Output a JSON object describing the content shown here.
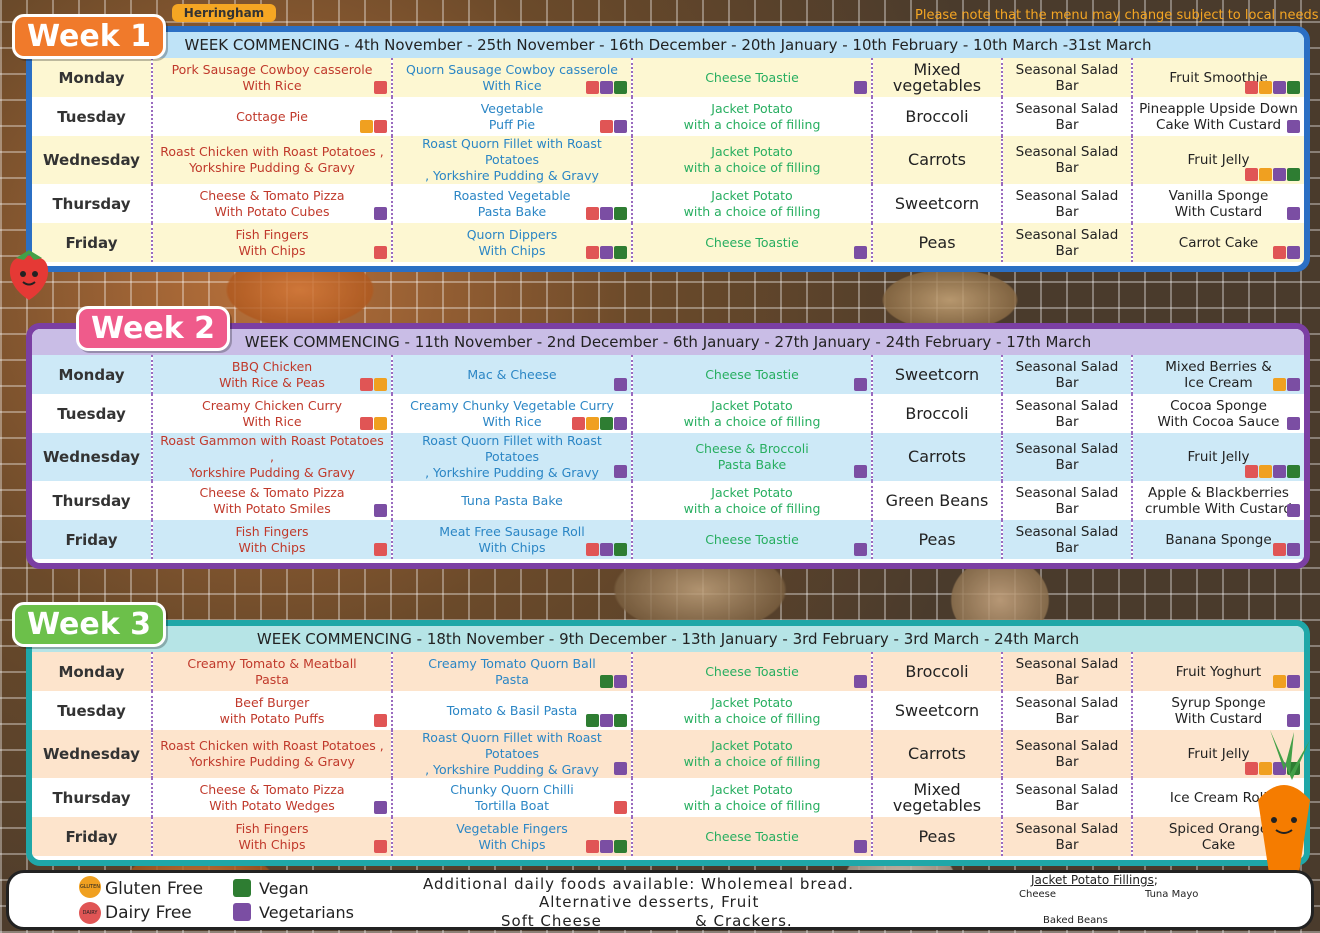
{
  "school": "Herringham",
  "note": "Please note that the menu may change subject to local needs",
  "weeks": [
    {
      "badge": "Week 1",
      "commencing": "WEEK COMMENCING - 4th November - 25th November - 16th December -  20th January - 10th February - 10th March -31st March",
      "color": "#2b6fc4",
      "rows": [
        {
          "day": "Monday",
          "main": "Pork Sausage Cowboy casserole\nWith Rice",
          "main_icons": [
            "df"
          ],
          "alt": "Quorn Sausage Cowboy casserole\nWith Rice",
          "alt_icons": [
            "df",
            "v",
            "vg"
          ],
          "third": "Cheese Toastie",
          "third_icons": [
            "v"
          ],
          "veg": "Mixed\nvegetables",
          "salad": "Seasonal Salad\nBar",
          "dessert": "Fruit Smoothie",
          "dessert_icons": [
            "df",
            "gf",
            "v",
            "vg"
          ]
        },
        {
          "day": "Tuesday",
          "main": "Cottage Pie",
          "main_icons": [
            "gf",
            "df"
          ],
          "alt": "Vegetable\nPuff Pie",
          "alt_icons": [
            "df",
            "v"
          ],
          "third": "Jacket Potato\nwith a choice of filling",
          "third_icons": [],
          "veg": "Broccoli",
          "salad": "Seasonal Salad\nBar",
          "dessert": "Pineapple Upside Down\nCake With Custard",
          "dessert_icons": [
            "v"
          ]
        },
        {
          "day": "Wednesday",
          "main": "Roast Chicken with Roast Potatoes ,\nYorkshire Pudding & Gravy",
          "main_icons": [],
          "alt": "Roast Quorn Fillet with Roast Potatoes\n, Yorkshire Pudding & Gravy",
          "alt_icons": [],
          "third": "Jacket Potato\nwith a choice of filling",
          "third_icons": [],
          "veg": "Carrots",
          "salad": "Seasonal Salad\nBar",
          "dessert": "Fruit Jelly",
          "dessert_icons": [
            "df",
            "gf",
            "v",
            "vg"
          ]
        },
        {
          "day": "Thursday",
          "main": "Cheese & Tomato Pizza\nWith Potato Cubes",
          "main_icons": [
            "v"
          ],
          "alt": "Roasted Vegetable\nPasta Bake",
          "alt_icons": [
            "df",
            "v",
            "vg"
          ],
          "third": "Jacket Potato\nwith a choice of filling",
          "third_icons": [],
          "veg": "Sweetcorn",
          "salad": "Seasonal Salad\nBar",
          "dessert": "Vanilla Sponge\nWith Custard",
          "dessert_icons": [
            "v"
          ]
        },
        {
          "day": "Friday",
          "main": "Fish Fingers\nWith Chips",
          "main_icons": [
            "df"
          ],
          "alt": "Quorn Dippers\nWith Chips",
          "alt_icons": [
            "df",
            "v",
            "vg"
          ],
          "third": "Cheese Toastie",
          "third_icons": [
            "v"
          ],
          "veg": "Peas",
          "salad": "Seasonal Salad\nBar",
          "dessert": "Carrot Cake",
          "dessert_icons": [
            "df",
            "v"
          ]
        }
      ]
    },
    {
      "badge": "Week 2",
      "commencing": "WEEK COMMENCING - 11th November - 2nd December - 6th January - 27th January - 24th February - 17th March",
      "color": "#7b3fa3",
      "rows": [
        {
          "day": "Monday",
          "main": "BBQ Chicken\nWith Rice & Peas",
          "main_icons": [
            "df",
            "gf"
          ],
          "alt": "Mac & Cheese",
          "alt_icons": [
            "v"
          ],
          "third": "Cheese Toastie",
          "third_icons": [
            "v"
          ],
          "veg": "Sweetcorn",
          "salad": "Seasonal Salad\nBar",
          "dessert": "Mixed Berries &\nIce Cream",
          "dessert_icons": [
            "gf",
            "v"
          ]
        },
        {
          "day": "Tuesday",
          "main": "Creamy Chicken Curry\nWith Rice",
          "main_icons": [
            "df",
            "gf"
          ],
          "alt": "Creamy Chunky Vegetable  Curry\nWith Rice",
          "alt_icons": [
            "df",
            "gf",
            "vg",
            "v"
          ],
          "third": "Jacket Potato\nwith a choice of filling",
          "third_icons": [],
          "veg": "Broccoli",
          "salad": "Seasonal Salad\nBar",
          "dessert": "Cocoa Sponge\nWith Cocoa Sauce",
          "dessert_icons": [
            "v"
          ]
        },
        {
          "day": "Wednesday",
          "main": "Roast Gammon with Roast Potatoes ,\nYorkshire Pudding & Gravy",
          "main_icons": [],
          "alt": "Roast Quorn Fillet with Roast Potatoes\n, Yorkshire Pudding & Gravy",
          "alt_icons": [
            "v"
          ],
          "third": "Cheese & Broccoli\nPasta Bake",
          "third_icons": [
            "v"
          ],
          "veg": "Carrots",
          "salad": "Seasonal Salad\nBar",
          "dessert": "Fruit Jelly",
          "dessert_icons": [
            "df",
            "gf",
            "v",
            "vg"
          ]
        },
        {
          "day": "Thursday",
          "main": "Cheese & Tomato Pizza\nWith Potato Smiles",
          "main_icons": [
            "v"
          ],
          "alt": "Tuna Pasta Bake",
          "alt_icons": [],
          "third": "Jacket Potato\nwith a choice of filling",
          "third_icons": [],
          "veg": "Green Beans",
          "salad": "Seasonal Salad\nBar",
          "dessert": "Apple & Blackberries\ncrumble With Custard",
          "dessert_icons": [
            "v"
          ]
        },
        {
          "day": "Friday",
          "main": "Fish Fingers\nWith Chips",
          "main_icons": [
            "df"
          ],
          "alt": "Meat Free Sausage Roll\nWith Chips",
          "alt_icons": [
            "df",
            "v",
            "vg"
          ],
          "third": "Cheese Toastie",
          "third_icons": [
            "v"
          ],
          "veg": "Peas",
          "salad": "Seasonal Salad\nBar",
          "dessert": "Banana Sponge",
          "dessert_icons": [
            "df",
            "v"
          ]
        }
      ]
    },
    {
      "badge": "Week 3",
      "commencing": "WEEK COMMENCING - 18th November - 9th December - 13th January - 3rd February - 3rd March - 24th March",
      "color": "#1fa7a8",
      "rows": [
        {
          "day": "Monday",
          "main": "Creamy Tomato & Meatball\nPasta",
          "main_icons": [],
          "alt": "Creamy Tomato Quorn Ball\nPasta",
          "alt_icons": [
            "vg",
            "v"
          ],
          "third": "Cheese Toastie",
          "third_icons": [
            "v"
          ],
          "veg": "Broccoli",
          "salad": "Seasonal Salad\nBar",
          "dessert": "Fruit Yoghurt",
          "dessert_icons": [
            "gf",
            "v"
          ]
        },
        {
          "day": "Tuesday",
          "main": "Beef Burger\nwith Potato Puffs",
          "main_icons": [
            "df"
          ],
          "alt": "Tomato & Basil Pasta",
          "alt_icons": [
            "vg",
            "v",
            "vg"
          ],
          "third": "Jacket Potato\nwith a choice of filling",
          "third_icons": [],
          "veg": "Sweetcorn",
          "salad": "Seasonal Salad\nBar",
          "dessert": "Syrup Sponge\nWith Custard",
          "dessert_icons": [
            "v"
          ]
        },
        {
          "day": "Wednesday",
          "main": "Roast Chicken with Roast Potatoes ,\nYorkshire Pudding & Gravy",
          "main_icons": [],
          "alt": "Roast Quorn Fillet with Roast Potatoes\n, Yorkshire Pudding & Gravy",
          "alt_icons": [
            "v"
          ],
          "third": "Jacket Potato\nwith a choice of filling",
          "third_icons": [],
          "veg": "Carrots",
          "salad": "Seasonal Salad\nBar",
          "dessert": "Fruit Jelly",
          "dessert_icons": [
            "df",
            "gf",
            "v",
            "vg"
          ]
        },
        {
          "day": "Thursday",
          "main": "Cheese & Tomato Pizza\nWith Potato Wedges",
          "main_icons": [
            "v"
          ],
          "alt": "Chunky Quorn Chilli\nTortilla Boat",
          "alt_icons": [
            "df"
          ],
          "third": "Jacket Potato\nwith a choice of filling",
          "third_icons": [],
          "veg": "Mixed\nvegetables",
          "salad": "Seasonal Salad\nBar",
          "dessert": "Ice Cream Roll",
          "dessert_icons": [
            "v"
          ]
        },
        {
          "day": "Friday",
          "main": "Fish Fingers\nWith Chips",
          "main_icons": [
            "df"
          ],
          "alt": "Vegetable Fingers\nWith Chips",
          "alt_icons": [
            "df",
            "v",
            "vg"
          ],
          "third": "Cheese Toastie",
          "third_icons": [
            "v"
          ],
          "veg": "Peas",
          "salad": "Seasonal Salad\nBar",
          "dessert": "Spiced Orange\nCake",
          "dessert_icons": [
            "v"
          ]
        }
      ]
    }
  ],
  "legend": {
    "gluten_free": "Gluten Free",
    "dairy_free": "Dairy Free",
    "vegan": "Vegan",
    "vegetarian": "Vegetarians",
    "additional": "Additional daily foods available: Wholemeal bread.",
    "alternative": "Alternative desserts, Fruit",
    "soft_cheese": "Soft Cheese",
    "crackers": "& Crackers.",
    "fillings_title": "Jacket Potato Fillings",
    "fillings_colon": ";",
    "filling_cheese": "Cheese",
    "filling_tuna": "Tuna Mayo",
    "filling_beans": "Baked Beans",
    "gf_icon_text": "GLUTEN FREE",
    "df_icon_text": "DAIRY FREE"
  }
}
